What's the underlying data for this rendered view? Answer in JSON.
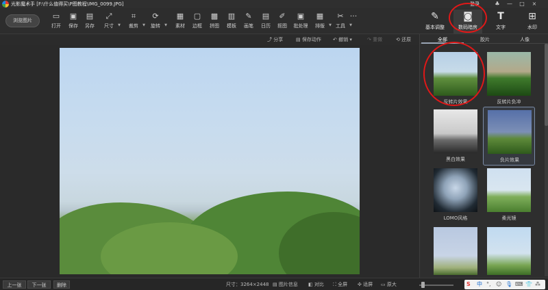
{
  "app": {
    "title": "光影魔术手 [F:\\什么值得买\\P图教程\\IMG_0099.JPG]",
    "login": "登录",
    "window_buttons": {
      "min": "—",
      "max": "□",
      "close": "×"
    }
  },
  "toolbar": {
    "browse": "浏览图片",
    "tools": [
      {
        "label": "打开",
        "icon": "open-icon"
      },
      {
        "label": "保存",
        "icon": "save-icon"
      },
      {
        "label": "另存",
        "icon": "save-as-icon"
      },
      {
        "label": "尺寸",
        "icon": "resize-icon"
      },
      {
        "label": "裁剪",
        "icon": "crop-icon"
      },
      {
        "label": "旋转",
        "icon": "rotate-icon"
      },
      {
        "label": "素材",
        "icon": "material-icon"
      },
      {
        "label": "边框",
        "icon": "border-icon"
      },
      {
        "label": "拼图",
        "icon": "collage-icon"
      },
      {
        "label": "模板",
        "icon": "template-icon"
      },
      {
        "label": "画笔",
        "icon": "brush-icon"
      },
      {
        "label": "日历",
        "icon": "calendar-icon"
      },
      {
        "label": "抠图",
        "icon": "cutout-icon"
      },
      {
        "label": "批处理",
        "icon": "batch-icon"
      },
      {
        "label": "排版",
        "icon": "layout-icon"
      },
      {
        "label": "工具",
        "icon": "tools-icon"
      }
    ],
    "more": "···",
    "modes": [
      {
        "label": "基本调整",
        "icon": "adjust-icon"
      },
      {
        "label": "数码暗房",
        "icon": "camera-icon"
      },
      {
        "label": "文字",
        "icon": "text-icon"
      },
      {
        "label": "水印",
        "icon": "watermark-icon"
      }
    ]
  },
  "subbar": {
    "share": "分享",
    "save_action": "保存动作",
    "undo": "撤销",
    "redo": "重做",
    "restore": "还原"
  },
  "panel": {
    "tabs": [
      "全部",
      "胶片",
      "人像"
    ],
    "effects": [
      {
        "label": "反转片效果"
      },
      {
        "label": "反转片负冲"
      },
      {
        "label": "黑白效果"
      },
      {
        "label": "负片效果"
      },
      {
        "label": "LOMO风格"
      },
      {
        "label": "柔光镜"
      },
      {
        "label": ""
      },
      {
        "label": ""
      }
    ]
  },
  "status": {
    "prev": "上一张",
    "next": "下一张",
    "delete": "删除",
    "size": "尺寸：3264×2448",
    "info": "图片信息",
    "compare": "对比",
    "fullscreen": "全屏",
    "fit": "适屏",
    "original": "原大"
  },
  "ime": {
    "brand": "S",
    "items": [
      "中",
      "°,",
      "☺",
      "🎙",
      "⌨",
      "👕",
      "⁂"
    ]
  }
}
